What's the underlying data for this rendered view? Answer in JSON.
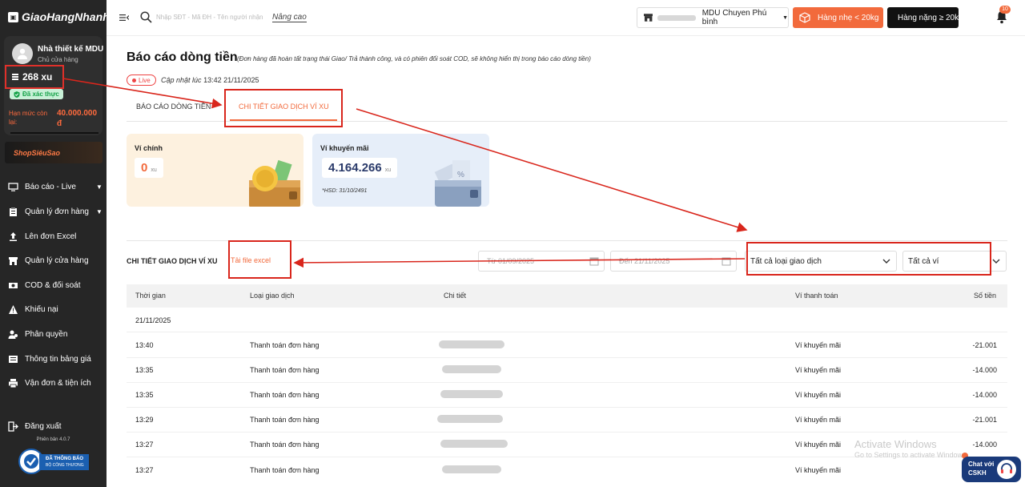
{
  "sidebar": {
    "logo": "GiaoHangNhanh",
    "user_name": "Nhà thiết kế MDU",
    "user_role": "Chủ cửa hàng",
    "xu_balance": "268 xu",
    "verified": "Đã xác thực",
    "limit_label": "Hạn mức còn lại:",
    "limit_value": "40.000.000 đ",
    "shopsieusao": "ShopSiêuSao",
    "menu": [
      {
        "label": "Báo cáo - Live",
        "icon": "monitor-icon"
      },
      {
        "label": "Quản lý đơn hàng",
        "icon": "clipboard-icon"
      },
      {
        "label": "Lên đơn Excel",
        "icon": "upload-icon"
      },
      {
        "label": "Quản lý cửa hàng",
        "icon": "store-icon"
      },
      {
        "label": "COD & đối soát",
        "icon": "money-icon"
      },
      {
        "label": "Khiếu nại",
        "icon": "warning-icon"
      },
      {
        "label": "Phân quyền",
        "icon": "users-icon"
      },
      {
        "label": "Thông tin bảng giá",
        "icon": "price-list-icon"
      },
      {
        "label": "Vận đơn & tiện ích",
        "icon": "printer-icon"
      }
    ],
    "logout": "Đăng xuất",
    "version": "Phiên bản 4.0.7",
    "badge_line1": "ĐÃ THÔNG BÁO",
    "badge_line2": "BỘ CÔNG THƯƠNG"
  },
  "topbar": {
    "search_placeholder": "Nhập SĐT - Mã ĐH - Tên người nhận",
    "advanced": "Nâng cao",
    "shop_name": "MDU Chuyen Phú bình",
    "btn_light": "Hàng nhẹ < 20kg",
    "btn_heavy": "Hàng nặng ≥ 20kg",
    "notif_count": "10"
  },
  "header": {
    "title": "Báo cáo dòng tiền",
    "note": "(Đơn hàng đã hoàn tất trạng thái Giao/ Trả thành công, và có phiên đối soát COD, sẽ không hiển thị trong báo cáo dòng tiền)",
    "live": "Live",
    "updated_label": "Cập nhật lúc",
    "updated_time": "13:42 21/11/2025"
  },
  "tabs": [
    "BÁO CÁO DÒNG TIỀN",
    "CHI TIẾT GIAO DỊCH VÍ XU"
  ],
  "wallets": {
    "main": {
      "label": "Ví chính",
      "amount": "0",
      "unit": "xu"
    },
    "promo": {
      "label": "Ví khuyến mãi",
      "amount": "4.164.266",
      "unit": "xu",
      "hsd": "*HSD: 31/10/2491"
    }
  },
  "details": {
    "title": "CHI TIẾT GIAO DỊCH VÍ XU",
    "excel": "Tải file excel",
    "from": "Từ 01/09/2025",
    "to": "Đến 21/11/2025",
    "type_select": "Tất cả loại giao dịch",
    "wallet_select": "Tất cả ví"
  },
  "table": {
    "headers": [
      "Thời gian",
      "Loại giao dịch",
      "Chi tiết",
      "Ví thanh toán",
      "Số tiền"
    ],
    "date_group": "21/11/2025",
    "rows": [
      {
        "time": "13:40",
        "type": "Thanh toán đơn hàng",
        "wallet": "Ví khuyến mãi",
        "amount": "-21.001"
      },
      {
        "time": "13:35",
        "type": "Thanh toán đơn hàng",
        "wallet": "Ví khuyến mãi",
        "amount": "-14.000"
      },
      {
        "time": "13:35",
        "type": "Thanh toán đơn hàng",
        "wallet": "Ví khuyến mãi",
        "amount": "-14.000"
      },
      {
        "time": "13:29",
        "type": "Thanh toán đơn hàng",
        "wallet": "Ví khuyến mãi",
        "amount": "-21.001"
      },
      {
        "time": "13:27",
        "type": "Thanh toán đơn hàng",
        "wallet": "Ví khuyến mãi",
        "amount": "-14.000"
      },
      {
        "time": "13:27",
        "type": "Thanh toán đơn hàng",
        "wallet": "Ví khuyến mãi",
        "amount": ""
      }
    ]
  },
  "overlay": {
    "watermark1": "Activate Windows",
    "watermark2": "Go to Settings to activate Windows.",
    "chat_line1": "Chat với",
    "chat_line2": "CSKH"
  },
  "colors": {
    "accent": "#f26a3c",
    "sidebar": "#262626",
    "annotation": "#d9261c"
  }
}
